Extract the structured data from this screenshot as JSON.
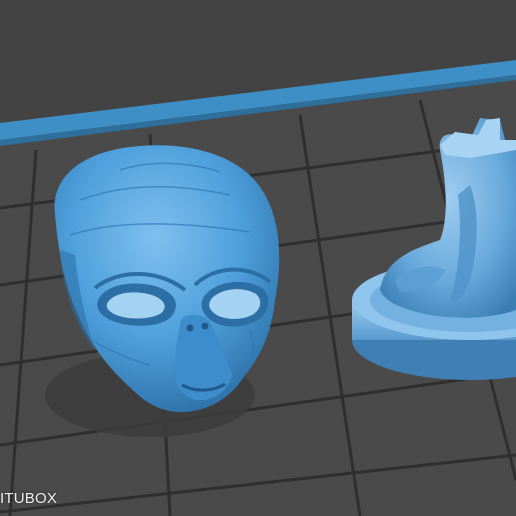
{
  "viewer": {
    "watermark": "ITUBOX",
    "colors": {
      "background": "#434343",
      "build_plate": "#4a4a4a",
      "grid_line": "#2e2e2e",
      "plate_border": "#3f8fc7",
      "model": "#4d9fdc",
      "model_shadow": "#2c6fa6",
      "base": "#6aaee0",
      "top_strip": "#2d8a45"
    },
    "icons": [
      "alien-head-model-icon",
      "bust-on-base-model-icon"
    ]
  }
}
